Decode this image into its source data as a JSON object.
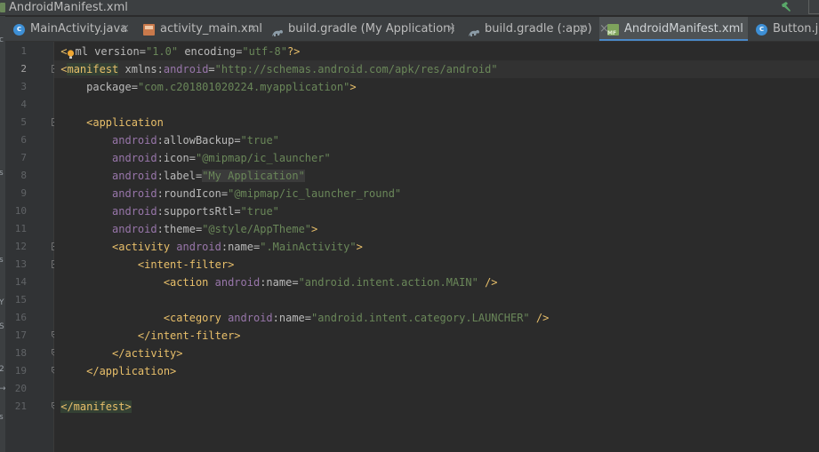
{
  "path_bar": {
    "file": "AndroidManifest.xml"
  },
  "side_strip": {
    "labels": [
      "c",
      "s",
      "s",
      "Y",
      "S",
      "2",
      "→",
      "s"
    ]
  },
  "tabs": [
    {
      "label": "MainActivity.java",
      "icon": "java-class-icon",
      "close": "×",
      "active": false
    },
    {
      "label": "activity_main.xml",
      "icon": "layout-xml-icon",
      "close": "×",
      "active": false
    },
    {
      "label": "build.gradle (My Application)",
      "icon": "gradle-icon",
      "close": "×",
      "active": false
    },
    {
      "label": "build.gradle (:app)",
      "icon": "gradle-icon",
      "close": "×",
      "active": false
    },
    {
      "label": "AndroidManifest.xml",
      "icon": "manifest-icon",
      "close": "×",
      "active": true
    },
    {
      "label": "Button.ja",
      "icon": "java-class-icon",
      "close": "",
      "active": false
    }
  ],
  "colors": {
    "tag": "#e8bf6a",
    "attribute": "#bababa",
    "namespace": "#9876aa",
    "string": "#6a8759",
    "text": "#a9b7c6",
    "active_tab_underline": "#4a88c7"
  },
  "editor": {
    "current_line": 2,
    "lines": [
      {
        "n": "1",
        "indent": "",
        "tokens": [
          {
            "t": "<",
            "c": "punc"
          },
          {
            "t": "?",
            "c": "bulb"
          },
          {
            "t": "ml ",
            "c": "attr"
          },
          {
            "t": "version",
            "c": "attr"
          },
          {
            "t": "=",
            "c": "attr"
          },
          {
            "t": "\"1.0\"",
            "c": "val"
          },
          {
            "t": " encoding",
            "c": "attr"
          },
          {
            "t": "=",
            "c": "attr"
          },
          {
            "t": "\"utf-8\"",
            "c": "val"
          },
          {
            "t": "?>",
            "c": "punc"
          }
        ]
      },
      {
        "n": "2",
        "indent": "",
        "tokens": [
          {
            "t": "<",
            "c": "punc"
          },
          {
            "t": "manifest",
            "c": "tag hl-tag"
          },
          {
            "t": " xmlns:",
            "c": "attr"
          },
          {
            "t": "android",
            "c": "ns"
          },
          {
            "t": "=",
            "c": "attr"
          },
          {
            "t": "\"http://schemas.android.com/apk/res/android\"",
            "c": "val"
          }
        ]
      },
      {
        "n": "3",
        "indent": "    ",
        "tokens": [
          {
            "t": "package",
            "c": "attr"
          },
          {
            "t": "=",
            "c": "attr"
          },
          {
            "t": "\"com.c201801020224.myapplication\"",
            "c": "val"
          },
          {
            "t": ">",
            "c": "punc"
          }
        ]
      },
      {
        "n": "4",
        "indent": "",
        "tokens": []
      },
      {
        "n": "5",
        "indent": "    ",
        "tokens": [
          {
            "t": "<application",
            "c": "tag"
          }
        ]
      },
      {
        "n": "6",
        "indent": "        ",
        "tokens": [
          {
            "t": "android",
            "c": "ns"
          },
          {
            "t": ":allowBackup",
            "c": "attr"
          },
          {
            "t": "=",
            "c": "attr"
          },
          {
            "t": "\"true\"",
            "c": "val"
          }
        ]
      },
      {
        "n": "7",
        "indent": "        ",
        "tokens": [
          {
            "t": "android",
            "c": "ns"
          },
          {
            "t": ":icon",
            "c": "attr"
          },
          {
            "t": "=",
            "c": "attr"
          },
          {
            "t": "\"@mipmap/ic_launcher\"",
            "c": "val"
          }
        ]
      },
      {
        "n": "8",
        "indent": "        ",
        "tokens": [
          {
            "t": "android",
            "c": "ns"
          },
          {
            "t": ":label",
            "c": "attr"
          },
          {
            "t": "=",
            "c": "attr"
          },
          {
            "t": "\"My Application\"",
            "c": "val hl-label"
          }
        ]
      },
      {
        "n": "9",
        "indent": "        ",
        "tokens": [
          {
            "t": "android",
            "c": "ns"
          },
          {
            "t": ":roundIcon",
            "c": "attr"
          },
          {
            "t": "=",
            "c": "attr"
          },
          {
            "t": "\"@mipmap/ic_launcher_round\"",
            "c": "val"
          }
        ]
      },
      {
        "n": "10",
        "indent": "        ",
        "tokens": [
          {
            "t": "android",
            "c": "ns"
          },
          {
            "t": ":supportsRtl",
            "c": "attr"
          },
          {
            "t": "=",
            "c": "attr"
          },
          {
            "t": "\"true\"",
            "c": "val"
          }
        ]
      },
      {
        "n": "11",
        "indent": "        ",
        "tokens": [
          {
            "t": "android",
            "c": "ns"
          },
          {
            "t": ":theme",
            "c": "attr"
          },
          {
            "t": "=",
            "c": "attr"
          },
          {
            "t": "\"@style/AppTheme\"",
            "c": "val"
          },
          {
            "t": ">",
            "c": "punc"
          }
        ]
      },
      {
        "n": "12",
        "indent": "        ",
        "tokens": [
          {
            "t": "<activity ",
            "c": "tag"
          },
          {
            "t": "android",
            "c": "ns"
          },
          {
            "t": ":name",
            "c": "attr"
          },
          {
            "t": "=",
            "c": "attr"
          },
          {
            "t": "\".MainActivity\"",
            "c": "val"
          },
          {
            "t": ">",
            "c": "punc"
          }
        ]
      },
      {
        "n": "13",
        "indent": "            ",
        "tokens": [
          {
            "t": "<intent-filter>",
            "c": "tag"
          }
        ]
      },
      {
        "n": "14",
        "indent": "                ",
        "tokens": [
          {
            "t": "<action ",
            "c": "tag"
          },
          {
            "t": "android",
            "c": "ns"
          },
          {
            "t": ":name",
            "c": "attr"
          },
          {
            "t": "=",
            "c": "attr"
          },
          {
            "t": "\"android.intent.action.MAIN\"",
            "c": "val"
          },
          {
            "t": " />",
            "c": "punc"
          }
        ]
      },
      {
        "n": "15",
        "indent": "",
        "tokens": []
      },
      {
        "n": "16",
        "indent": "                ",
        "tokens": [
          {
            "t": "<category ",
            "c": "tag"
          },
          {
            "t": "android",
            "c": "ns"
          },
          {
            "t": ":name",
            "c": "attr"
          },
          {
            "t": "=",
            "c": "attr"
          },
          {
            "t": "\"android.intent.category.LAUNCHER\"",
            "c": "val"
          },
          {
            "t": " />",
            "c": "punc"
          }
        ]
      },
      {
        "n": "17",
        "indent": "            ",
        "tokens": [
          {
            "t": "</intent-filter>",
            "c": "tag"
          }
        ]
      },
      {
        "n": "18",
        "indent": "        ",
        "tokens": [
          {
            "t": "</activity>",
            "c": "tag"
          }
        ]
      },
      {
        "n": "19",
        "indent": "    ",
        "tokens": [
          {
            "t": "</application>",
            "c": "tag"
          }
        ]
      },
      {
        "n": "20",
        "indent": "",
        "tokens": []
      },
      {
        "n": "21",
        "indent": "",
        "tokens": [
          {
            "t": "</manifest>",
            "c": "tag hl-tag"
          }
        ]
      }
    ],
    "folds": [
      {
        "line": "2",
        "kind": "open"
      },
      {
        "line": "5",
        "kind": "open"
      },
      {
        "line": "12",
        "kind": "open"
      },
      {
        "line": "13",
        "kind": "open"
      },
      {
        "line": "17",
        "kind": "close"
      },
      {
        "line": "18",
        "kind": "close"
      },
      {
        "line": "19",
        "kind": "close"
      },
      {
        "line": "21",
        "kind": "close"
      }
    ]
  }
}
